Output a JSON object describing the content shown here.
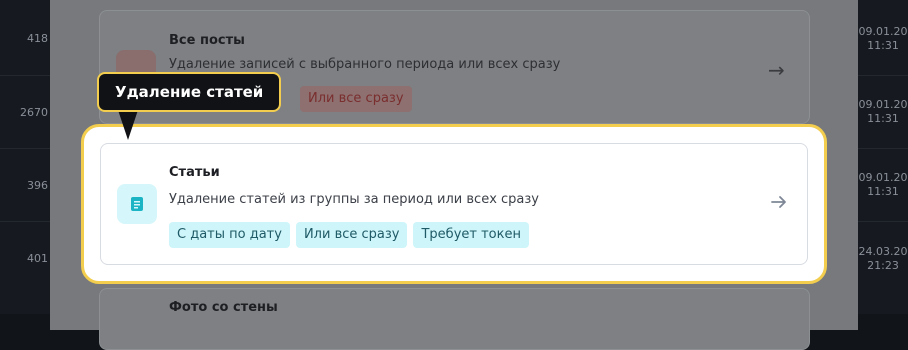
{
  "background": {
    "left_values": [
      "418",
      "2670",
      "396",
      "401"
    ],
    "right_dates": [
      {
        "date": "09.01.20",
        "time": "11:31"
      },
      {
        "date": "09.01.20",
        "time": "11:31"
      },
      {
        "date": "09.01.20",
        "time": "11:31"
      },
      {
        "date": "24.03.20",
        "time": "21:23"
      }
    ]
  },
  "cards": {
    "all_posts": {
      "title": "Все посты",
      "description": "Удаление записей с выбранного периода или всех сразу",
      "tag": "Или все сразу"
    },
    "articles": {
      "title": "Статьи",
      "description": "Удаление статей из группы за период или всех сразу",
      "tags": [
        "С даты по дату",
        "Или все сразу",
        "Требует токен"
      ],
      "icon": "document-icon"
    },
    "wall_photos": {
      "title": "Фото со стены"
    }
  },
  "tooltip": {
    "text": "Удаление статей"
  },
  "colors": {
    "highlight": "#f2cd4e",
    "tag_bg": "#cdf5fa",
    "icon_accent": "#1ab4c4"
  }
}
